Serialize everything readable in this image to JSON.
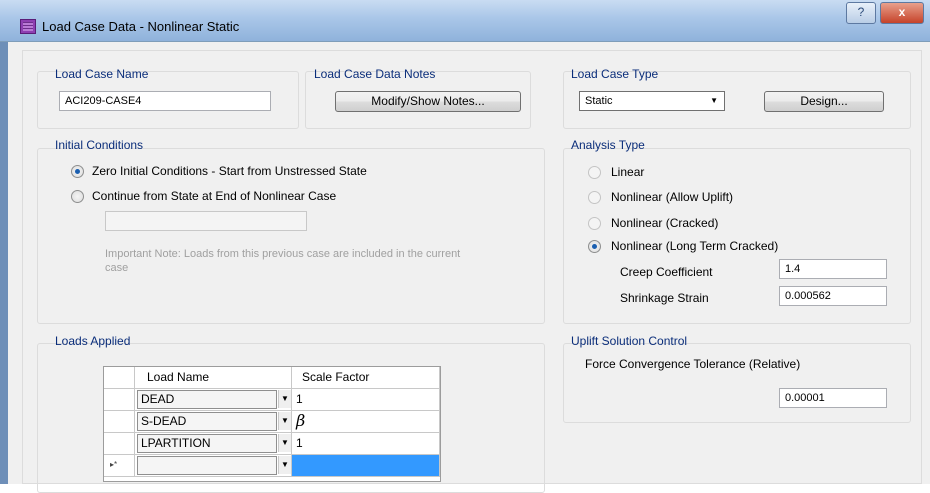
{
  "window": {
    "title": "Load Case Data - Nonlinear Static",
    "help_label": "?",
    "close_label": "x"
  },
  "load_case_name": {
    "title": "Load Case Name",
    "value": "ACI209-CASE4"
  },
  "notes": {
    "title": "Load Case Data Notes",
    "button_label": "Modify/Show Notes..."
  },
  "case_type": {
    "title": "Load Case Type",
    "selected": "Static",
    "design_label": "Design..."
  },
  "initial_conditions": {
    "title": "Initial Conditions",
    "option_zero": "Zero Initial Conditions - Start from Unstressed State",
    "option_continue": "Continue from State at End of Nonlinear Case",
    "continue_value": "",
    "note_line1": "Important Note:  Loads from this previous case are included in the current",
    "note_line2": "case"
  },
  "analysis_type": {
    "title": "Analysis Type",
    "options": [
      "Linear",
      "Nonlinear (Allow Uplift)",
      "Nonlinear (Cracked)",
      "Nonlinear (Long Term Cracked)"
    ],
    "selected_index": 3,
    "creep_label": "Creep Coefficient",
    "creep_value": "1.4",
    "shrinkage_label": "Shrinkage Strain",
    "shrinkage_value": "0.000562"
  },
  "loads_applied": {
    "title": "Loads Applied",
    "headers": [
      "Load Name",
      "Scale Factor"
    ],
    "rows": [
      {
        "name": "DEAD",
        "factor": "1"
      },
      {
        "name": "S-DEAD",
        "factor": "β"
      },
      {
        "name": "LPARTITION",
        "factor": "1"
      },
      {
        "name": "",
        "factor": ""
      }
    ],
    "new_row_marker": "▸*"
  },
  "uplift": {
    "title": "Uplift Solution Control",
    "tolerance_label": "Force Convergence Tolerance (Relative)",
    "tolerance_value": "0.00001"
  },
  "colors": {
    "group_title": "#0a2d7a",
    "selected_cell": "#3399ff"
  },
  "icons": [
    "app-grid-icon",
    "help-icon",
    "close-icon",
    "dropdown-arrow-icon",
    "new-row-marker-icon"
  ]
}
